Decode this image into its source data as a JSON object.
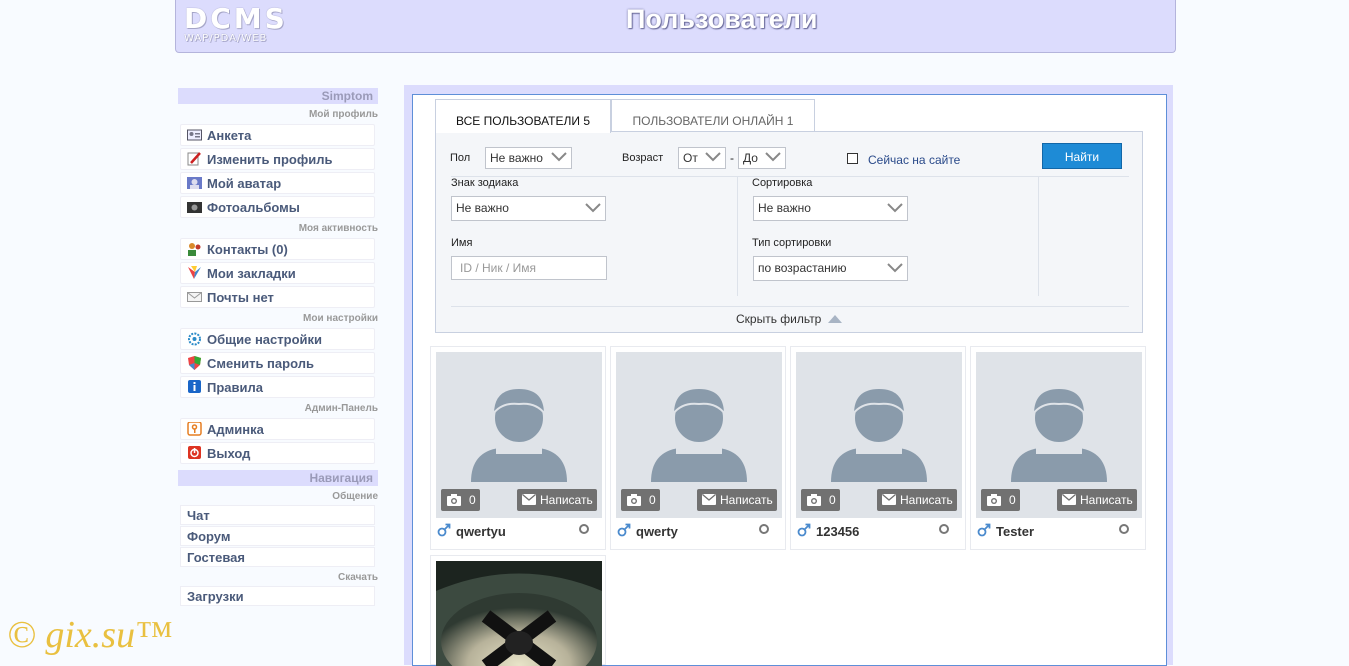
{
  "header": {
    "logo_main": "DCMS",
    "logo_sub": "WAP/PDA/WEB",
    "title": "Пользователи"
  },
  "sidebar": {
    "title": "Simptom",
    "sections": [
      {
        "heading": "Мой профиль",
        "items": [
          "Анкета",
          "Изменить профиль",
          "Мой аватар",
          "Фотоальбомы"
        ]
      },
      {
        "heading": "Моя активность",
        "items": [
          "Контакты (0)",
          "Мои закладки",
          "Почты нет"
        ]
      },
      {
        "heading": "Мои настройки",
        "items": [
          "Общие настройки",
          "Сменить пароль",
          "Правила"
        ]
      },
      {
        "heading": "Админ-Панель",
        "items": [
          "Админка",
          "Выход"
        ]
      }
    ],
    "nav_title": "Навигация",
    "nav_sections": [
      {
        "heading": "Общение",
        "items": [
          "Чат",
          "Форум",
          "Гостевая"
        ]
      },
      {
        "heading": "Скачать",
        "items": [
          "Загрузки"
        ]
      }
    ]
  },
  "tabs": {
    "all": "ВСЕ ПОЛЬЗОВАТЕЛИ 5",
    "online": "ПОЛЬЗОВАТЕЛИ ОНЛАЙН 1"
  },
  "filter": {
    "gender_label": "Пол",
    "gender_value": "Не важно",
    "age_label": "Возраст",
    "age_from": "От",
    "age_dash": "-",
    "age_to": "До",
    "online_label": "Сейчас на сайте",
    "find_button": "Найти",
    "zodiac_label": "Знак зодиака",
    "zodiac_value": "Не важно",
    "sort_label": "Сортировка",
    "sort_value": "Не важно",
    "name_label": "Имя",
    "name_placeholder": "ID / Ник / Имя",
    "sort_type_label": "Тип сортировки",
    "sort_type_value": "по возрастанию",
    "hide_filter": "Скрыть фильтр"
  },
  "users": [
    {
      "name": "qwertyu",
      "photos": "0",
      "write": "Написать"
    },
    {
      "name": "qwerty",
      "photos": "0",
      "write": "Написать"
    },
    {
      "name": "123456",
      "photos": "0",
      "write": "Написать"
    },
    {
      "name": "Tester",
      "photos": "0",
      "write": "Написать"
    }
  ],
  "watermark": "© gix.su™",
  "colors": {
    "header_bg": "#dcdcfd",
    "accent_button": "#1e8bd6",
    "frame_border": "#5e8fd8"
  }
}
